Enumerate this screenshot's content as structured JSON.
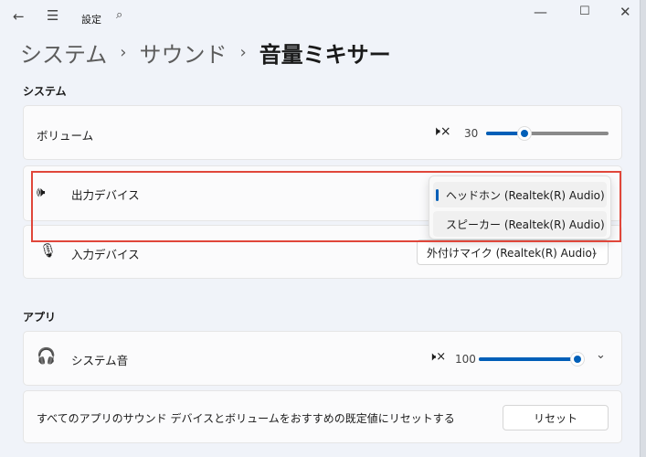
{
  "titlebar": {
    "title": "設定",
    "back_icon": "arrow-left-icon",
    "menu_icon": "hamburger-icon",
    "search_icon": "search-icon"
  },
  "breadcrumb": [
    "システム",
    "サウンド",
    "音量ミキサー"
  ],
  "system_section": {
    "title": "システム",
    "volume": {
      "label": "ボリューム",
      "value": "30",
      "percent": 30
    },
    "output": {
      "label": "出力デバイス",
      "options": [
        "ヘッドホン (Realtek(R) Audio)",
        "スピーカー (Realtek(R) Audio)"
      ],
      "selected": 0
    },
    "input": {
      "label": "入力デバイス",
      "value": "外付けマイク (Realtek(R) Audio)"
    }
  },
  "apps_section": {
    "title": "アプリ",
    "system_sound": {
      "label": "システム音",
      "value": "100",
      "percent": 100
    },
    "reset": {
      "text": "すべてのアプリのサウンド デバイスとボリュームをおすすめの既定値にリセットする",
      "button": "リセット"
    }
  },
  "colors": {
    "accent": "#005fb8",
    "highlight": "#e0463a"
  }
}
